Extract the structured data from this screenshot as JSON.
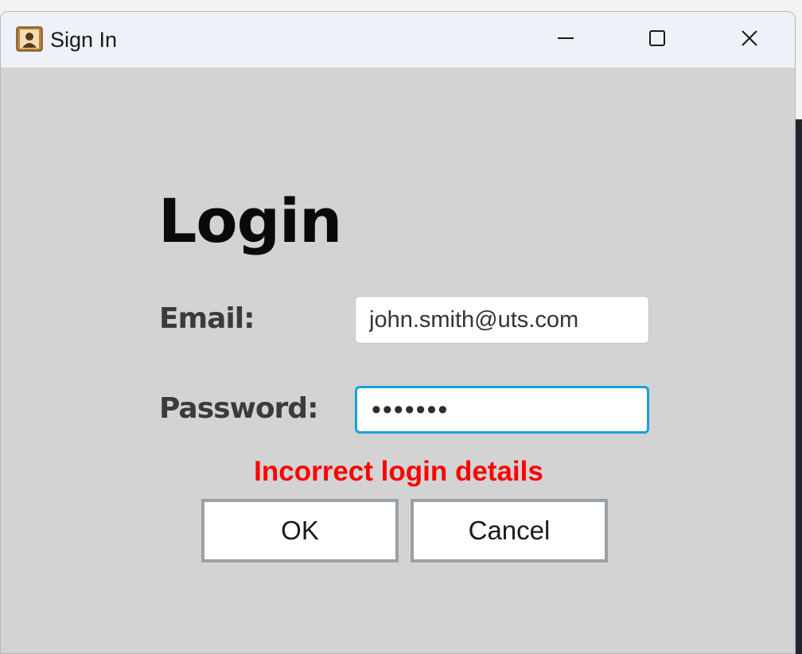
{
  "window": {
    "title": "Sign In",
    "icon": "contact-card-icon",
    "controls": {
      "minimize": "minimize-icon",
      "maximize": "maximize-icon",
      "close": "close-icon"
    }
  },
  "form": {
    "heading": "Login",
    "email_label": "Email:",
    "email_value": "john.smith@uts.com",
    "password_label": "Password:",
    "password_value": "•••••••",
    "error_message": "Incorrect login details",
    "ok_label": "OK",
    "cancel_label": "Cancel"
  },
  "colors": {
    "background": "#d3d3d3",
    "titlebar": "#eef1f8",
    "error": "#ff0000",
    "focus_border": "#1aa0d8",
    "button_border": "#9aa0a8"
  }
}
